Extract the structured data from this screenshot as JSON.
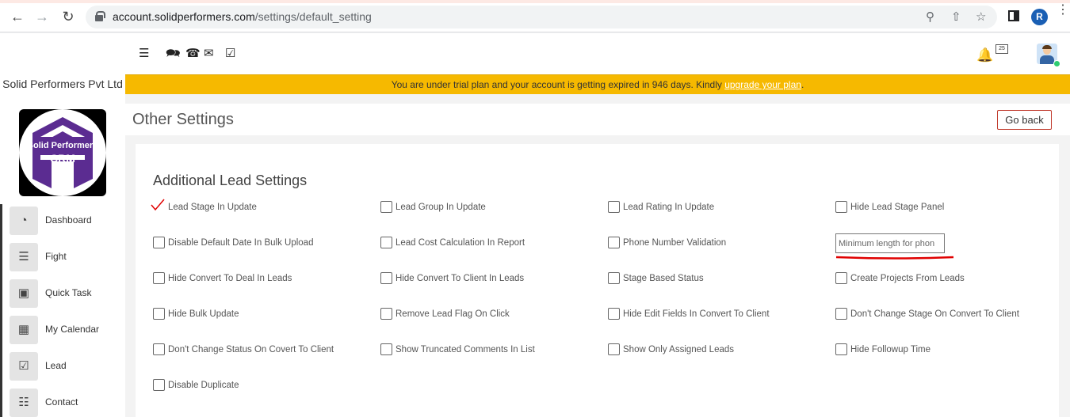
{
  "browser": {
    "url_host": "account.solidperformers.com",
    "url_path": "/settings/default_setting",
    "profile_initial": "R"
  },
  "sidebar": {
    "company_name": "Solid Performers Pvt Ltd",
    "logo_line1": "Solid Performers",
    "logo_line2": "CRM",
    "items": [
      {
        "label": "Dashboard",
        "icon": "gauge-icon"
      },
      {
        "label": "Fight",
        "icon": "list-icon"
      },
      {
        "label": "Quick Task",
        "icon": "note-icon"
      },
      {
        "label": "My Calendar",
        "icon": "calendar-icon"
      },
      {
        "label": "Lead",
        "icon": "checkbox-icon"
      },
      {
        "label": "Contact",
        "icon": "contact-card-icon"
      }
    ]
  },
  "topbar": {
    "notification_count": "25"
  },
  "trial_banner": {
    "text": "You are under trial plan and your account is getting expired in 946 days. Kindly ",
    "link": "upgrade your plan",
    "suffix": "."
  },
  "page": {
    "title": "Other Settings",
    "go_back": "Go back"
  },
  "settings": {
    "section_title": "Additional Lead Settings",
    "options": [
      {
        "label": "Lead Stage In Update",
        "checked": true
      },
      {
        "label": "Lead Group In Update",
        "checked": false
      },
      {
        "label": "Lead Rating In Update",
        "checked": false
      },
      {
        "label": "Hide Lead Stage Panel",
        "checked": false
      },
      {
        "label": "Disable Default Date In Bulk Upload",
        "checked": false
      },
      {
        "label": "Lead Cost Calculation In Report",
        "checked": false
      },
      {
        "label": "Phone Number Validation",
        "checked": false
      },
      {
        "label": "Hide Convert To Deal In Leads",
        "checked": false
      },
      {
        "label": "Hide Convert To Client In Leads",
        "checked": false
      },
      {
        "label": "Stage Based Status",
        "checked": false
      },
      {
        "label": "Create Projects From Leads",
        "checked": false
      },
      {
        "label": "Hide Bulk Update",
        "checked": false
      },
      {
        "label": "Remove Lead Flag On Click",
        "checked": false
      },
      {
        "label": "Hide Edit Fields In Convert To Client",
        "checked": false
      },
      {
        "label": "Don't Change Stage On Convert To Client",
        "checked": false
      },
      {
        "label": "Don't Change Status On Covert To Client",
        "checked": false
      },
      {
        "label": "Show Truncated Comments In List",
        "checked": false
      },
      {
        "label": "Show Only Assigned Leads",
        "checked": false
      },
      {
        "label": "Hide Followup Time",
        "checked": false
      },
      {
        "label": "Disable Duplicate",
        "checked": false
      }
    ],
    "min_length_value": "Minimum length for phon"
  },
  "colors": {
    "banner": "#f6b900",
    "accent_red": "#e00000",
    "logo_purple": "#5b2c91"
  }
}
